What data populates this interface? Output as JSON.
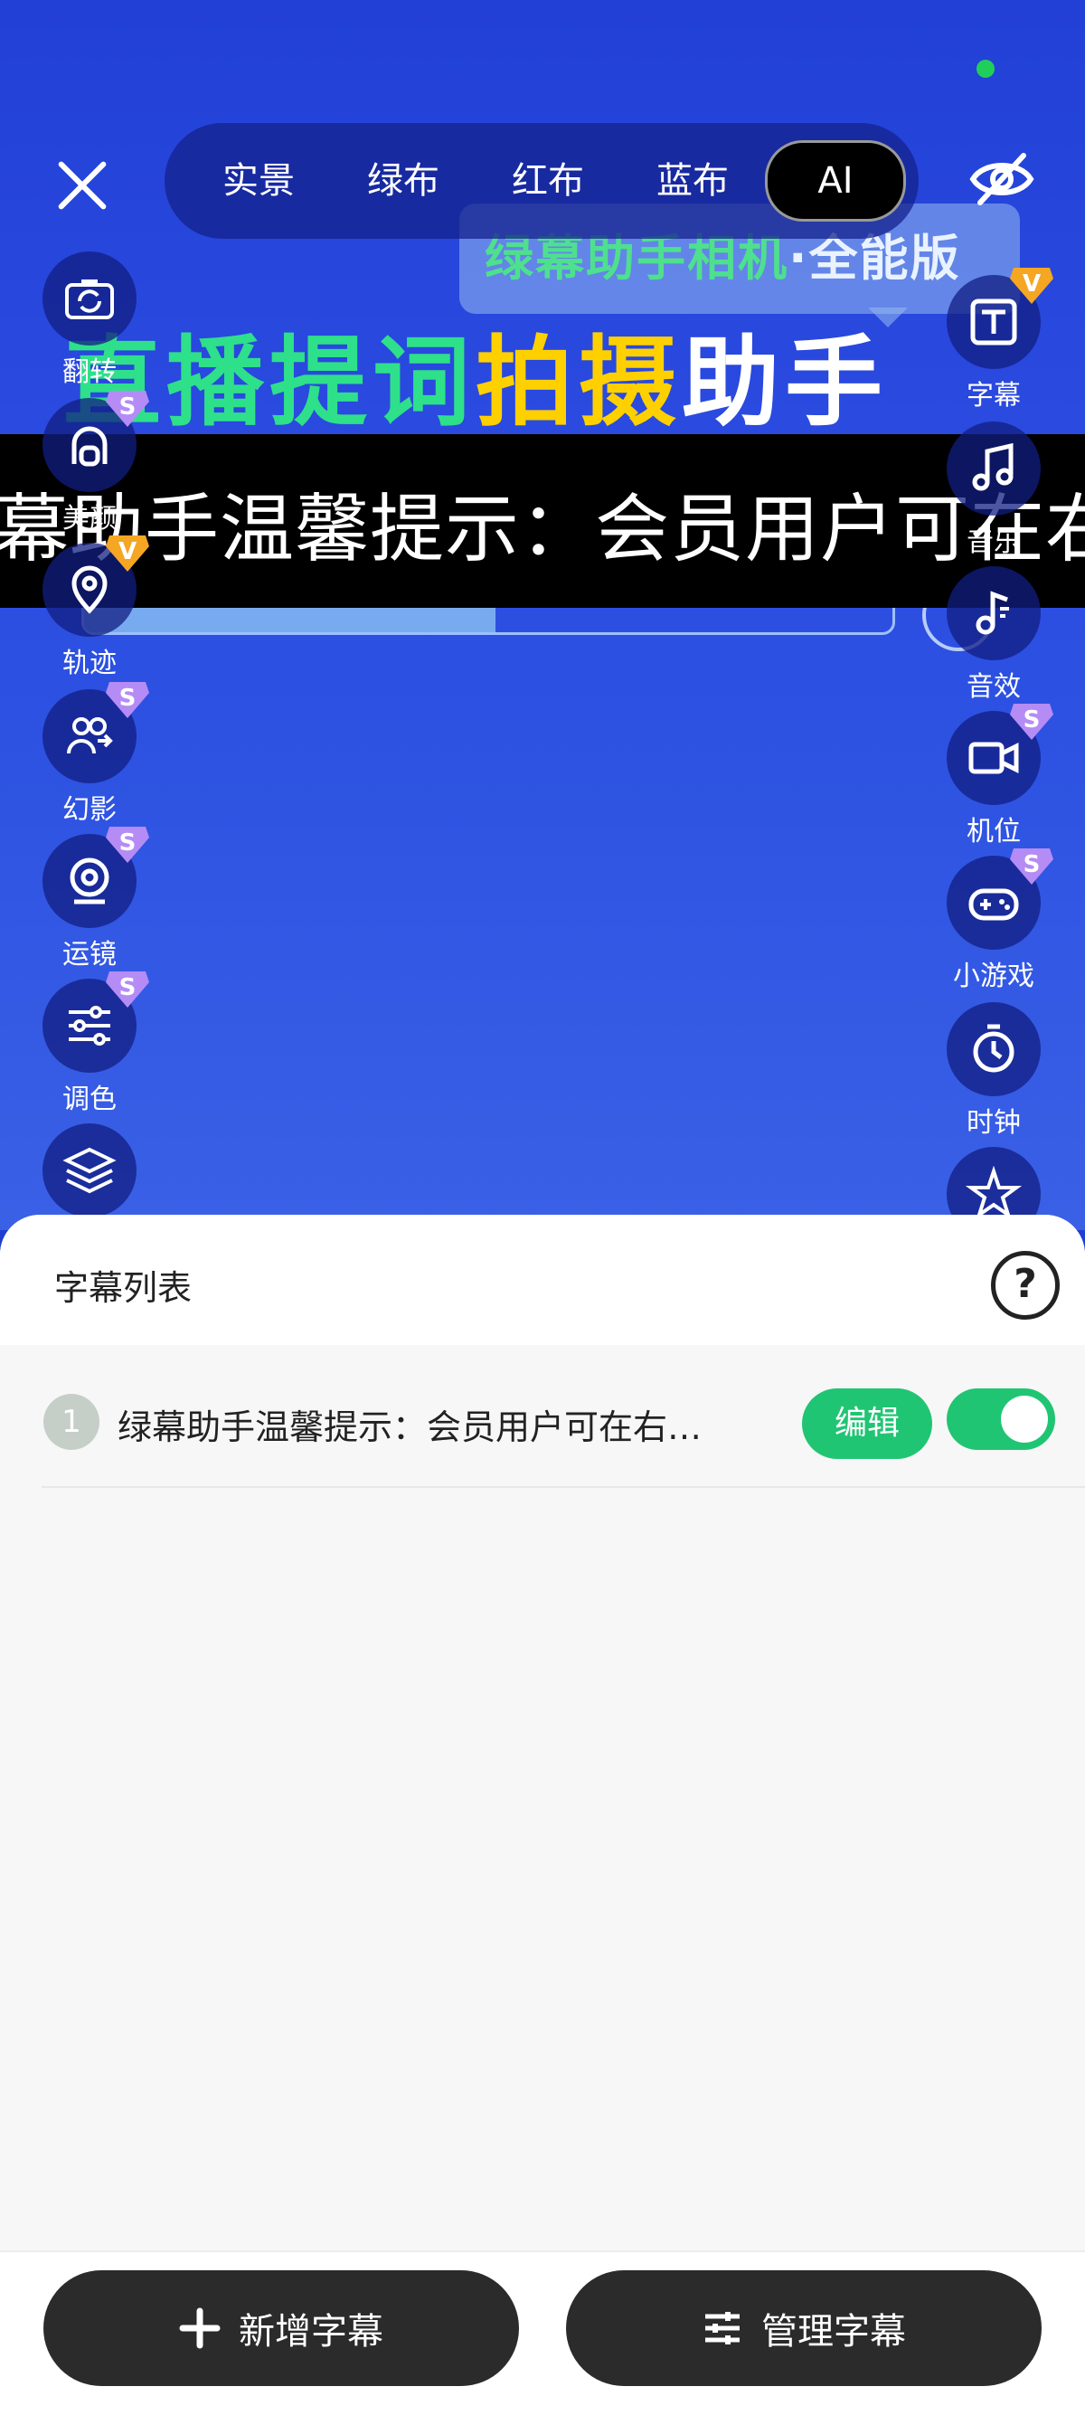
{
  "preview": {
    "banner_main": "绿幕助手相机",
    "banner_dot": "·",
    "banner_tail": "全能版",
    "headline_green": "直播提词",
    "headline_yellow": "拍摄",
    "headline_white": "助手",
    "ticker_text": "幕助手温馨提示：会员用户可在右"
  },
  "mode_tabs": [
    {
      "label": "实景"
    },
    {
      "label": "绿布"
    },
    {
      "label": "红布"
    },
    {
      "label": "蓝布"
    },
    {
      "label": "AI",
      "active": true
    }
  ],
  "left_tools": [
    {
      "label": "翻转",
      "icon": "camera-flip-icon"
    },
    {
      "label": "美颜",
      "icon": "beauty-icon",
      "badge": "S"
    },
    {
      "label": "轨迹",
      "icon": "location-icon",
      "badge": "V"
    },
    {
      "label": "幻影",
      "icon": "phantom-icon",
      "badge": "S"
    },
    {
      "label": "运镜",
      "icon": "webcam-icon",
      "badge": "S"
    },
    {
      "label": "调色",
      "icon": "sliders-icon",
      "badge": "S"
    },
    {
      "label": "",
      "icon": "layers-icon"
    }
  ],
  "right_tools": [
    {
      "label": "字幕",
      "icon": "text-icon",
      "badge": "V"
    },
    {
      "label": "音乐",
      "icon": "music-icon"
    },
    {
      "label": "音效",
      "icon": "sound-effect-icon"
    },
    {
      "label": "机位",
      "icon": "video-camera-icon",
      "badge": "S"
    },
    {
      "label": "小游戏",
      "icon": "gamepad-icon",
      "badge": "S"
    },
    {
      "label": "时钟",
      "icon": "clock-icon"
    },
    {
      "label": "",
      "icon": "star-icon"
    }
  ],
  "sheet": {
    "title": "字幕列表",
    "help": "?",
    "items": [
      {
        "index": "1",
        "text": "绿幕助手温馨提示：会员用户可在右…",
        "edit_label": "编辑",
        "enabled": true
      }
    ],
    "add_label": "新增字幕",
    "manage_label": "管理字幕"
  },
  "colors": {
    "accent": "#1fc573",
    "preview_blue": "#2240d6",
    "dark_button": "#2b2b2b"
  }
}
